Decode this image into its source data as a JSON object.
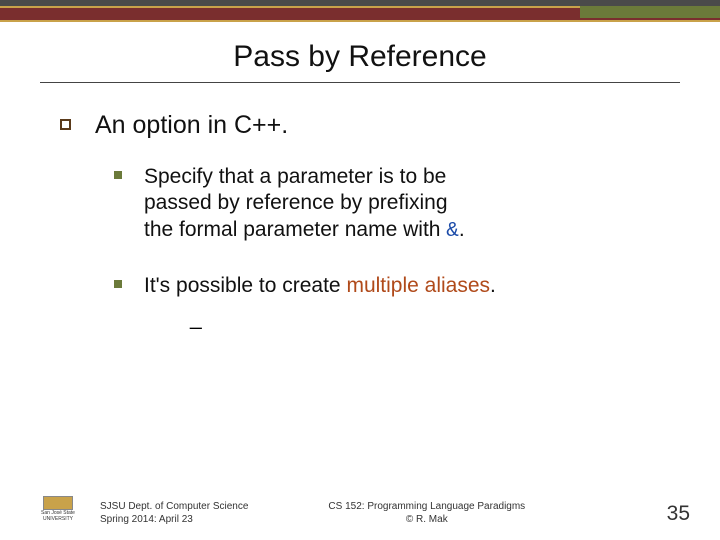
{
  "title": "Pass by Reference",
  "bullet1": "An option in C++.",
  "sub1_a": "Specify that a parameter is to be",
  "sub1_b": "passed by reference by prefixing",
  "sub1_c": "the formal parameter name with ",
  "amp": "&",
  "period": ".",
  "sub2_a": "It's possible to create ",
  "sub2_hl": "multiple aliases",
  "sub2_b": ".",
  "underscore": "_",
  "footer_left_1": "SJSU Dept. of Computer Science",
  "footer_left_2": "Spring 2014: April 23",
  "footer_center_1": "CS 152: Programming Language Paradigms",
  "footer_center_2": "© R. Mak",
  "page_number": "35",
  "logo_text_1": "San José State",
  "logo_text_2": "UNIVERSITY"
}
